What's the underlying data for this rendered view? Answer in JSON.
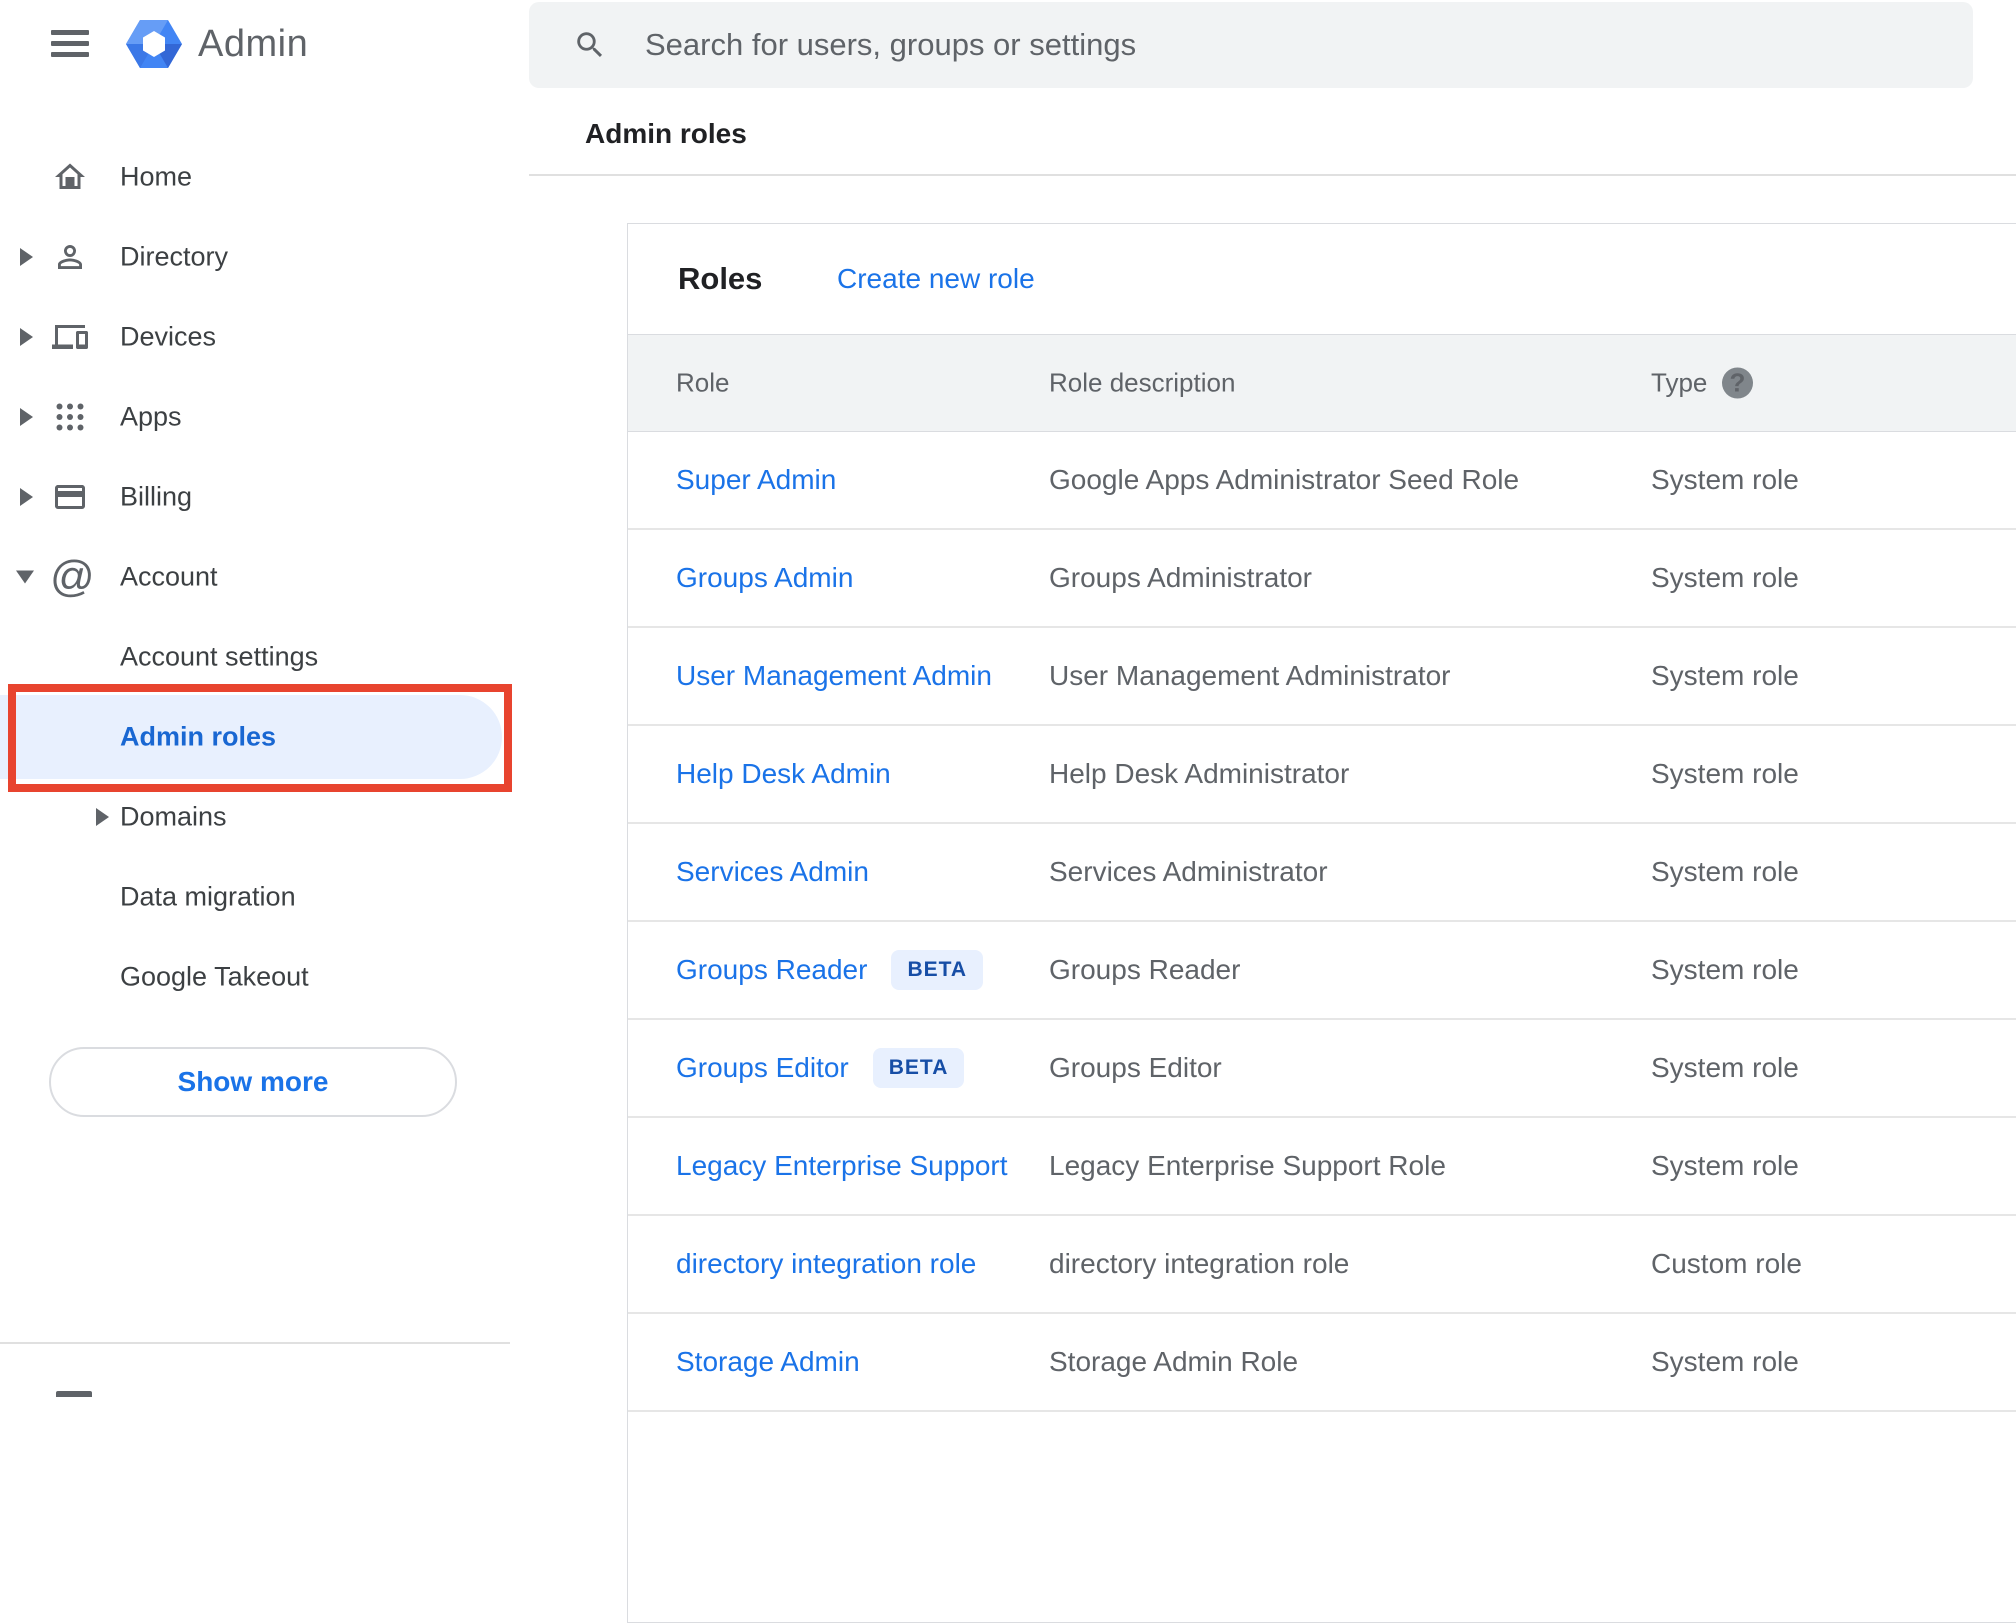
{
  "header": {
    "logo_text": "Admin",
    "search_placeholder": "Search for users, groups or settings"
  },
  "sidebar": {
    "items": [
      {
        "id": "home",
        "label": "Home",
        "level": "top",
        "icon": "home-icon",
        "expand": null,
        "selected": false
      },
      {
        "id": "directory",
        "label": "Directory",
        "level": "top",
        "icon": "person-icon",
        "expand": "collapsed",
        "selected": false
      },
      {
        "id": "devices",
        "label": "Devices",
        "level": "top",
        "icon": "devices-icon",
        "expand": "collapsed",
        "selected": false
      },
      {
        "id": "apps",
        "label": "Apps",
        "level": "top",
        "icon": "apps-grid-icon",
        "expand": "collapsed",
        "selected": false
      },
      {
        "id": "billing",
        "label": "Billing",
        "level": "top",
        "icon": "credit-card-icon",
        "expand": "collapsed",
        "selected": false
      },
      {
        "id": "account",
        "label": "Account",
        "level": "top",
        "icon": "at-sign-icon",
        "expand": "expanded",
        "selected": false
      },
      {
        "id": "account-settings",
        "label": "Account settings",
        "level": "sub",
        "icon": null,
        "expand": null,
        "selected": false
      },
      {
        "id": "admin-roles",
        "label": "Admin roles",
        "level": "sub",
        "icon": null,
        "expand": null,
        "selected": true,
        "annotated": true
      },
      {
        "id": "domains",
        "label": "Domains",
        "level": "sub",
        "icon": null,
        "expand": "collapsed",
        "selected": false
      },
      {
        "id": "data-migration",
        "label": "Data migration",
        "level": "sub",
        "icon": null,
        "expand": null,
        "selected": false
      },
      {
        "id": "google-takeout",
        "label": "Google Takeout",
        "level": "sub",
        "icon": null,
        "expand": null,
        "selected": false
      }
    ],
    "show_more_label": "Show more"
  },
  "breadcrumb": "Admin roles",
  "roles_card": {
    "title": "Roles",
    "create_link": "Create new role",
    "columns": [
      "Role",
      "Role description",
      "Type"
    ],
    "help_icon_glyph": "?",
    "beta_label": "BETA",
    "rows": [
      {
        "role": "Super Admin",
        "beta": false,
        "description": "Google Apps Administrator Seed Role",
        "type": "System role"
      },
      {
        "role": "Groups Admin",
        "beta": false,
        "description": "Groups Administrator",
        "type": "System role"
      },
      {
        "role": "User Management Admin",
        "beta": false,
        "description": "User Management Administrator",
        "type": "System role"
      },
      {
        "role": "Help Desk Admin",
        "beta": false,
        "description": "Help Desk Administrator",
        "type": "System role"
      },
      {
        "role": "Services Admin",
        "beta": false,
        "description": "Services Administrator",
        "type": "System role"
      },
      {
        "role": "Groups Reader",
        "beta": true,
        "description": "Groups Reader",
        "type": "System role"
      },
      {
        "role": "Groups Editor",
        "beta": true,
        "description": "Groups Editor",
        "type": "System role"
      },
      {
        "role": "Legacy Enterprise Support",
        "beta": false,
        "description": "Legacy Enterprise Support Role",
        "type": "System role"
      },
      {
        "role": "directory integration role",
        "beta": false,
        "description": "directory integration role",
        "type": "Custom role"
      },
      {
        "role": "Storage Admin",
        "beta": false,
        "description": "Storage Admin Role",
        "type": "System role"
      }
    ]
  },
  "colors": {
    "accent_blue": "#1a73e8",
    "selected_blue": "#1967d2",
    "selected_bg": "#e8f0fe",
    "annotation_red": "#e8442f",
    "beta_bg": "#e8f0fe",
    "beta_text": "#174ea6",
    "header_row_bg": "#f1f3f4",
    "search_bg": "#f1f3f4",
    "icon_gray": "#5f6368",
    "text_dark": "#202124",
    "text_gray": "#5f6368",
    "divider": "#e0e0e0",
    "logo_blue": "#4285f4"
  }
}
